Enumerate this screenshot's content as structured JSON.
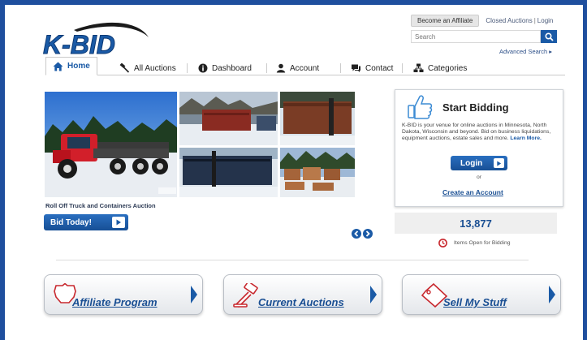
{
  "header": {
    "logo_text": "K-BID",
    "affiliate_button": "Become an Affiliate",
    "closed_auctions": "Closed Auctions",
    "separator": "|",
    "login": "Login",
    "search_placeholder": "Search",
    "advanced_search": "Advanced Search ▸"
  },
  "nav": {
    "items": [
      {
        "label": "Home",
        "icon": "home-icon",
        "active": true
      },
      {
        "label": "All Auctions",
        "icon": "gavel-icon"
      },
      {
        "label": "Dashboard",
        "icon": "info-icon"
      },
      {
        "label": "Account",
        "icon": "user-icon"
      },
      {
        "label": "Contact",
        "icon": "chat-icon"
      },
      {
        "label": "Categories",
        "icon": "sitemap-icon"
      }
    ]
  },
  "featured": {
    "caption": "Roll Off Truck and Containers Auction",
    "bid_button": "Bid Today!"
  },
  "start_bidding": {
    "title": "Start Bidding",
    "description": "K-BID is your venue for online auctions in Minnesota, North Dakota, Wisconsin and beyond. Bid on business liquidations, equipment auctions, estate sales and more.",
    "learn_more": "Learn More.",
    "login_button": "Login",
    "or": "or",
    "create_account": "Create an Account"
  },
  "stats": {
    "count": "13,877",
    "label": "Items Open for Bidding"
  },
  "actions": [
    {
      "label": "Affiliate Program",
      "icon": "badge-icon"
    },
    {
      "label": "Current Auctions",
      "icon": "gavel-icon"
    },
    {
      "label": "Sell My Stuff",
      "icon": "tag-icon"
    }
  ],
  "colors": {
    "frame": "#1f4f9e",
    "accent": "#1a5aa6",
    "text_link": "#1a4f93",
    "icon_red": "#c8282e"
  }
}
